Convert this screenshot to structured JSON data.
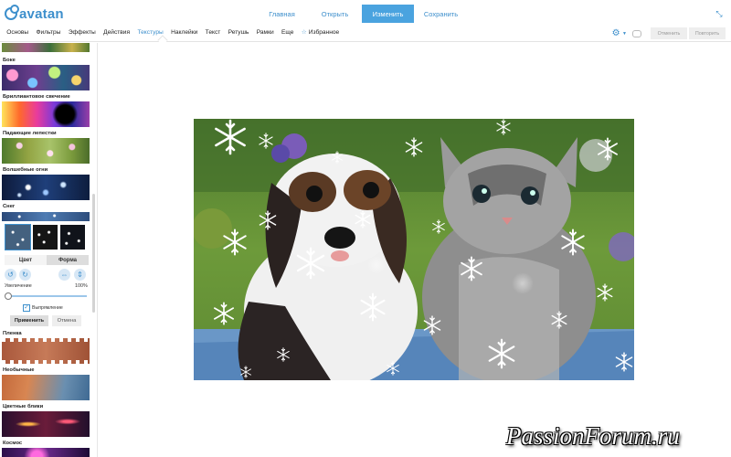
{
  "app": {
    "logo_text": "avatan"
  },
  "top_nav": [
    {
      "label": "Главная",
      "active": false
    },
    {
      "label": "Открыть",
      "active": false
    },
    {
      "label": "Изменить",
      "active": true
    },
    {
      "label": "Сохранить",
      "active": false
    }
  ],
  "menu": {
    "items": [
      "Основы",
      "Фильтры",
      "Эффекты",
      "Действия",
      "Текстуры",
      "Наклейки",
      "Текст",
      "Ретушь",
      "Рамки",
      "Еще"
    ],
    "active": "Текстуры",
    "favorites": "Избранное",
    "undo": "Отменить",
    "redo": "Повторить"
  },
  "sidebar": {
    "textures": [
      "Боке",
      "Бриллиантовое свечение",
      "Падающие лепестки",
      "Волшебные огни",
      "Снег",
      "Пленка",
      "Необычные",
      "Цветные блики",
      "Космос"
    ],
    "snow_panel": {
      "tabs": [
        "Цвет",
        "Форма"
      ],
      "active_tab": "Форма",
      "zoom_label": "Увеличение",
      "zoom_value": "100%",
      "zoom_level": 0,
      "checkbox_label": "Выпрямление",
      "checkbox_checked": true,
      "apply": "Применить",
      "cancel": "Отмена"
    }
  },
  "watermark": "PassionForum.ru",
  "colors": {
    "accent": "#3d8fcc",
    "active_tab": "#4aa3df"
  },
  "icons": [
    "logo-icon",
    "expand-icon",
    "star-icon",
    "gear-icon",
    "chat-icon",
    "rotate-left-icon",
    "rotate-right-icon",
    "flip-horizontal-icon",
    "flip-vertical-icon",
    "check-icon"
  ]
}
